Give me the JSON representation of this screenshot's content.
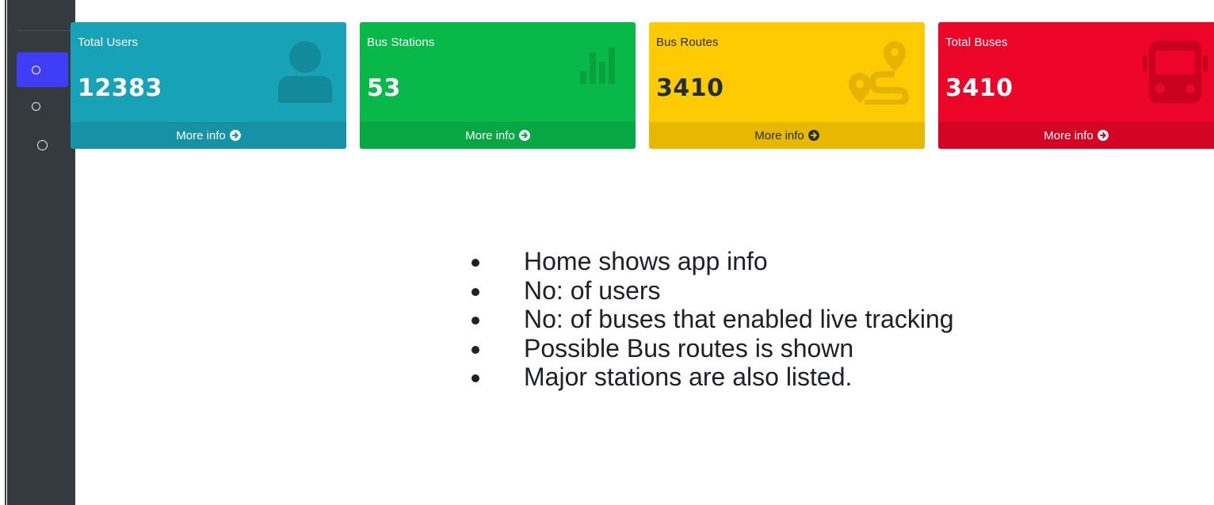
{
  "sidebar": {
    "items": [
      {
        "icon": "circle-outline-icon",
        "active": true
      },
      {
        "icon": "circle-outline-icon",
        "active": false
      },
      {
        "icon": "circle-outline-icon",
        "active": false
      }
    ],
    "active_color": "#3f3df5",
    "background": "#343a40"
  },
  "stats": [
    {
      "title": "Total Users",
      "value": "12383",
      "more": "More info",
      "icon": "user-icon",
      "color": "#17a2b8"
    },
    {
      "title": "Bus Stations",
      "value": "53",
      "more": "More info",
      "icon": "bar-chart-icon",
      "color": "#08b94a"
    },
    {
      "title": "Bus Routes",
      "value": "3410",
      "more": "More info",
      "icon": "route-icon",
      "color": "#fecb02"
    },
    {
      "title": "Total Buses",
      "value": "3410",
      "more": "More info",
      "icon": "bus-icon",
      "color": "#ec0529"
    }
  ],
  "notes": [
    "Home shows app info",
    "No: of users",
    "No: of buses that enabled live tracking",
    "Possible Bus routes is shown",
    "Major stations are also listed."
  ]
}
